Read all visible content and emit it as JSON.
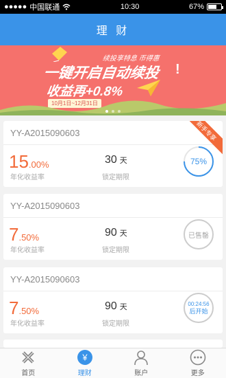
{
  "status_bar": {
    "carrier": "中国联通",
    "time": "10:30",
    "battery": "67%",
    "battery_level": 0.67
  },
  "nav": {
    "title": "理 财"
  },
  "banner": {
    "tagline": "续投享特息 币得惠",
    "headline": "一键开启自动续投",
    "exclaim": "!",
    "subline": "收益再+0.8%",
    "date_range": "10月1日~12月31日",
    "slides": 3,
    "active_slide": 0
  },
  "products": [
    {
      "code": "YY-A2015090603",
      "rate_int": "15",
      "rate_dec": ".00%",
      "rate_label": "年化收益率",
      "term": "30",
      "term_unit": "天",
      "term_label": "锁定期限",
      "status": "progress",
      "progress_text": "75%",
      "progress": 0.75,
      "ribbon": "新手专享"
    },
    {
      "code": "YY-A2015090603",
      "rate_int": "7",
      "rate_dec": ".50%",
      "rate_label": "年化收益率",
      "term": "90",
      "term_unit": "天",
      "term_label": "锁定期限",
      "status": "sold",
      "status_text": "已售罄"
    },
    {
      "code": "YY-A2015090603",
      "rate_int": "7",
      "rate_dec": ".50%",
      "rate_label": "年化收益率",
      "term": "90",
      "term_unit": "天",
      "term_label": "锁定期限",
      "status": "countdown",
      "countdown": "00:24:56",
      "countdown_label": "后开始"
    }
  ],
  "tabs": [
    {
      "label": "首页",
      "icon": "home-icon",
      "active": false
    },
    {
      "label": "理财",
      "icon": "yen-icon",
      "active": true
    },
    {
      "label": "账户",
      "icon": "user-icon",
      "active": false
    },
    {
      "label": "更多",
      "icon": "more-icon",
      "active": false
    }
  ],
  "colors": {
    "primary": "#3a93e8",
    "accent": "#f26b3a",
    "banner": "#f5716c"
  }
}
